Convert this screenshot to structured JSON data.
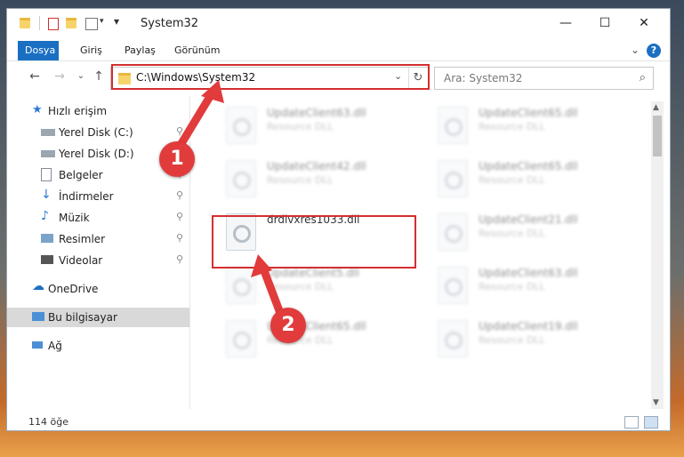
{
  "window": {
    "title": "System32",
    "controls": {
      "minimize": "—",
      "maximize": "☐",
      "close": "✕"
    }
  },
  "ribbon": {
    "tabs": [
      "Dosya",
      "Giriş",
      "Paylaş",
      "Görünüm"
    ],
    "help": "?"
  },
  "navigation": {
    "address": "C:\\Windows\\System32",
    "search_placeholder": "Ara: System32"
  },
  "sidebar": {
    "items": [
      {
        "label": "Hızlı erişim",
        "icon": "star-icon",
        "pinned": false
      },
      {
        "label": "Yerel Disk (C:)",
        "icon": "drive-icon",
        "pinned": true
      },
      {
        "label": "Yerel Disk (D:)",
        "icon": "drive-icon",
        "pinned": true
      },
      {
        "label": "Belgeler",
        "icon": "document-icon",
        "pinned": true
      },
      {
        "label": "İndirmeler",
        "icon": "download-icon",
        "pinned": true
      },
      {
        "label": "Müzik",
        "icon": "music-icon",
        "pinned": true
      },
      {
        "label": "Resimler",
        "icon": "pictures-icon",
        "pinned": true
      },
      {
        "label": "Videolar",
        "icon": "video-icon",
        "pinned": true
      },
      {
        "label": "OneDrive",
        "icon": "cloud-icon",
        "pinned": false
      },
      {
        "label": "Bu bilgisayar",
        "icon": "computer-icon",
        "pinned": false
      },
      {
        "label": "Ağ",
        "icon": "network-icon",
        "pinned": false
      }
    ]
  },
  "files": [
    {
      "name": "UpdateClient63.dll",
      "type": "Resource DLL"
    },
    {
      "name": "UpdateClient65.dll",
      "type": "Resource DLL"
    },
    {
      "name": "UpdateClient42.dll",
      "type": "Resource DLL"
    },
    {
      "name": "UpdateClient65.dll",
      "type": "Resource DLL"
    },
    {
      "name": "drdivxres1033.dll",
      "type": ""
    },
    {
      "name": "UpdateClient21.dll",
      "type": "Resource DLL"
    },
    {
      "name": "UpdateClient5.dll",
      "type": "Resource DLL"
    },
    {
      "name": "UpdateClient63.dll",
      "type": "Resource DLL"
    },
    {
      "name": "UpdateClient65.dll",
      "type": "Resource DLL"
    },
    {
      "name": "UpdateClient19.dll",
      "type": "Resource DLL"
    }
  ],
  "status": {
    "item_count": "114 öğe"
  },
  "annotations": {
    "step1": "1",
    "step2": "2"
  },
  "colors": {
    "accent": "#1a6fc2",
    "highlight": "#d42e2e"
  }
}
